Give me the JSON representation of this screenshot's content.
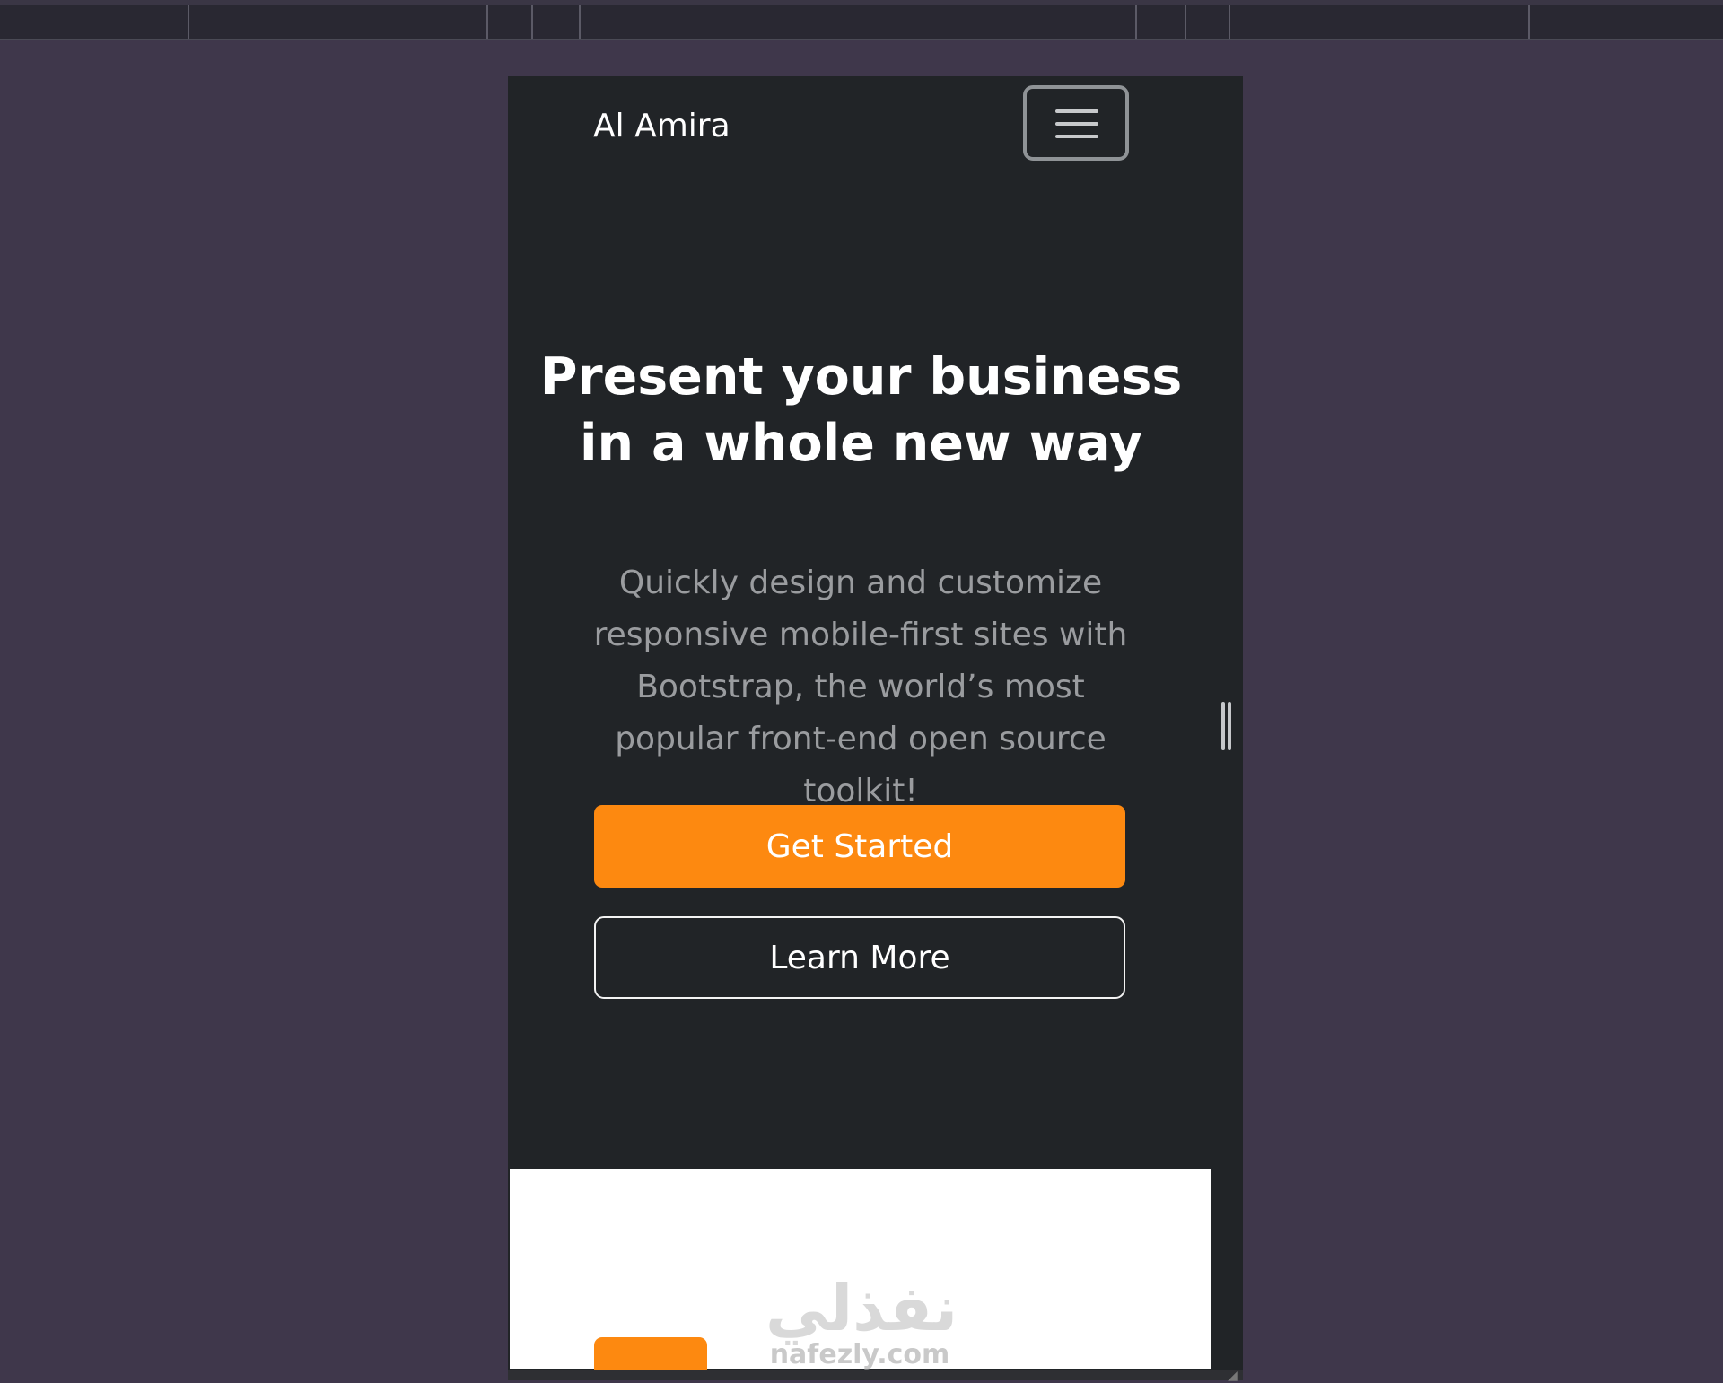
{
  "brand": "Al Amira",
  "nav": {
    "menu_icon": "hamburger-menu-icon"
  },
  "hero": {
    "title": "Present your business in a whole new way",
    "subtitle": "Quickly design and customize responsive mobile-first sites with Bootstrap, the world’s most popular front-end open source toolkit!",
    "primary_button": "Get Started",
    "secondary_button": "Learn More"
  },
  "watermark": {
    "arabic": "نفذلي",
    "latin": "nafezly.com"
  },
  "colors": {
    "page_bg": "#3f374b",
    "hero_bg": "#212427",
    "accent": "#fd8910"
  }
}
